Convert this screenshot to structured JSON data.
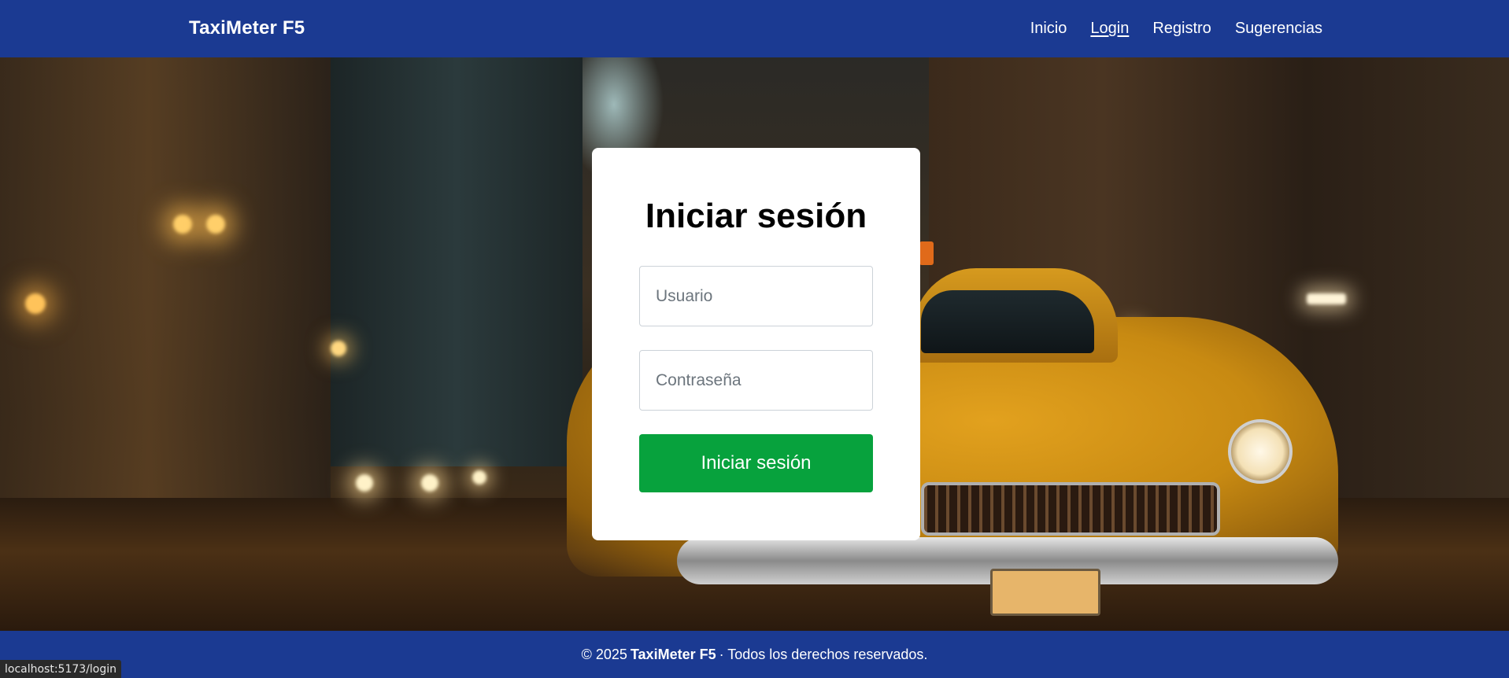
{
  "header": {
    "brand": "TaxiMeter F5",
    "nav": [
      {
        "label": "Inicio",
        "active": false
      },
      {
        "label": "Login",
        "active": true
      },
      {
        "label": "Registro",
        "active": false
      },
      {
        "label": "Sugerencias",
        "active": false
      }
    ]
  },
  "login": {
    "title": "Iniciar sesión",
    "username": {
      "placeholder": "Usuario",
      "value": ""
    },
    "password": {
      "placeholder": "Contraseña",
      "value": ""
    },
    "submit_label": "Iniciar sesión"
  },
  "footer": {
    "prefix": "© 2025",
    "brand": "TaxiMeter F5",
    "suffix": "· Todos los derechos reservados."
  },
  "status_bar": {
    "url": "localhost:5173/login"
  },
  "colors": {
    "primary": "#1b3a92",
    "success": "#07a23d",
    "card": "#ffffff"
  }
}
